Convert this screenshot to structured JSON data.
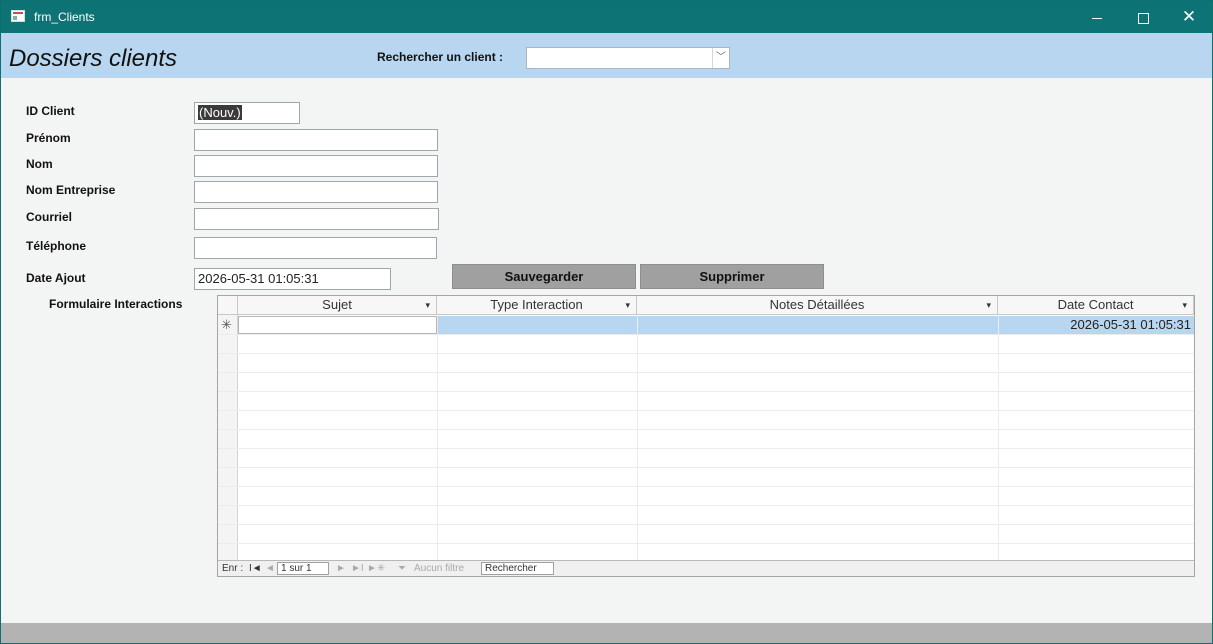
{
  "window": {
    "title": "frm_Clients",
    "accent": "#0e7375"
  },
  "header": {
    "form_title": "Dossiers clients",
    "search_label": "Rechercher un client :",
    "search_value": "",
    "bg": "#b8d6ef"
  },
  "fields": {
    "id_client": {
      "label": "ID Client",
      "value": "(Nouv.)"
    },
    "prenom": {
      "label": "Prénom",
      "value": ""
    },
    "nom": {
      "label": "Nom",
      "value": ""
    },
    "entreprise": {
      "label": "Nom Entreprise",
      "value": ""
    },
    "courriel": {
      "label": "Courriel",
      "value": ""
    },
    "telephone": {
      "label": "Téléphone",
      "value": ""
    },
    "date_ajout": {
      "label": "Date Ajout",
      "value": "2026-05-31 01:05:31"
    }
  },
  "buttons": {
    "save": "Sauvegarder",
    "delete": "Supprimer"
  },
  "subform": {
    "label": "Formulaire Interactions",
    "columns": [
      "Sujet",
      "Type Interaction",
      "Notes Détaillées",
      "Date Contact"
    ],
    "new_row": {
      "marker": "✳",
      "date_contact": "2026-05-31 01:05:31",
      "highlight": "#b8d6ef"
    },
    "navigation": {
      "record_label": "Enr :",
      "first": "I◄",
      "prev": "◄",
      "position": "1 sur 1",
      "next": "►",
      "last": "►I",
      "new": "►✳",
      "filter": "Aucun filtre",
      "search": "Rechercher"
    }
  }
}
